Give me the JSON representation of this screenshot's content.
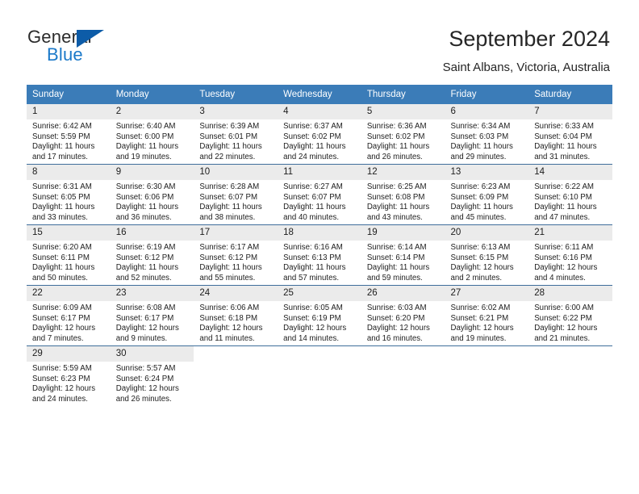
{
  "brand": {
    "name_top": "General",
    "name_bottom": "Blue",
    "triangle_color": "#0d5ca8",
    "blue_color": "#1b79c9"
  },
  "header": {
    "title": "September 2024",
    "subtitle": "Saint Albans, Victoria, Australia",
    "header_bg": "#3b7cb8",
    "daynum_bg": "#ebebeb"
  },
  "weekday_headers": [
    "Sunday",
    "Monday",
    "Tuesday",
    "Wednesday",
    "Thursday",
    "Friday",
    "Saturday"
  ],
  "labels": {
    "sunrise_prefix": "Sunrise:",
    "sunset_prefix": "Sunset:",
    "daylight_prefix": "Daylight:"
  },
  "weeks": [
    [
      {
        "day": "1",
        "sunrise": "Sunrise: 6:42 AM",
        "sunset": "Sunset: 5:59 PM",
        "daylight_line1": "Daylight: 11 hours",
        "daylight_line2": "and 17 minutes."
      },
      {
        "day": "2",
        "sunrise": "Sunrise: 6:40 AM",
        "sunset": "Sunset: 6:00 PM",
        "daylight_line1": "Daylight: 11 hours",
        "daylight_line2": "and 19 minutes."
      },
      {
        "day": "3",
        "sunrise": "Sunrise: 6:39 AM",
        "sunset": "Sunset: 6:01 PM",
        "daylight_line1": "Daylight: 11 hours",
        "daylight_line2": "and 22 minutes."
      },
      {
        "day": "4",
        "sunrise": "Sunrise: 6:37 AM",
        "sunset": "Sunset: 6:02 PM",
        "daylight_line1": "Daylight: 11 hours",
        "daylight_line2": "and 24 minutes."
      },
      {
        "day": "5",
        "sunrise": "Sunrise: 6:36 AM",
        "sunset": "Sunset: 6:02 PM",
        "daylight_line1": "Daylight: 11 hours",
        "daylight_line2": "and 26 minutes."
      },
      {
        "day": "6",
        "sunrise": "Sunrise: 6:34 AM",
        "sunset": "Sunset: 6:03 PM",
        "daylight_line1": "Daylight: 11 hours",
        "daylight_line2": "and 29 minutes."
      },
      {
        "day": "7",
        "sunrise": "Sunrise: 6:33 AM",
        "sunset": "Sunset: 6:04 PM",
        "daylight_line1": "Daylight: 11 hours",
        "daylight_line2": "and 31 minutes."
      }
    ],
    [
      {
        "day": "8",
        "sunrise": "Sunrise: 6:31 AM",
        "sunset": "Sunset: 6:05 PM",
        "daylight_line1": "Daylight: 11 hours",
        "daylight_line2": "and 33 minutes."
      },
      {
        "day": "9",
        "sunrise": "Sunrise: 6:30 AM",
        "sunset": "Sunset: 6:06 PM",
        "daylight_line1": "Daylight: 11 hours",
        "daylight_line2": "and 36 minutes."
      },
      {
        "day": "10",
        "sunrise": "Sunrise: 6:28 AM",
        "sunset": "Sunset: 6:07 PM",
        "daylight_line1": "Daylight: 11 hours",
        "daylight_line2": "and 38 minutes."
      },
      {
        "day": "11",
        "sunrise": "Sunrise: 6:27 AM",
        "sunset": "Sunset: 6:07 PM",
        "daylight_line1": "Daylight: 11 hours",
        "daylight_line2": "and 40 minutes."
      },
      {
        "day": "12",
        "sunrise": "Sunrise: 6:25 AM",
        "sunset": "Sunset: 6:08 PM",
        "daylight_line1": "Daylight: 11 hours",
        "daylight_line2": "and 43 minutes."
      },
      {
        "day": "13",
        "sunrise": "Sunrise: 6:23 AM",
        "sunset": "Sunset: 6:09 PM",
        "daylight_line1": "Daylight: 11 hours",
        "daylight_line2": "and 45 minutes."
      },
      {
        "day": "14",
        "sunrise": "Sunrise: 6:22 AM",
        "sunset": "Sunset: 6:10 PM",
        "daylight_line1": "Daylight: 11 hours",
        "daylight_line2": "and 47 minutes."
      }
    ],
    [
      {
        "day": "15",
        "sunrise": "Sunrise: 6:20 AM",
        "sunset": "Sunset: 6:11 PM",
        "daylight_line1": "Daylight: 11 hours",
        "daylight_line2": "and 50 minutes."
      },
      {
        "day": "16",
        "sunrise": "Sunrise: 6:19 AM",
        "sunset": "Sunset: 6:12 PM",
        "daylight_line1": "Daylight: 11 hours",
        "daylight_line2": "and 52 minutes."
      },
      {
        "day": "17",
        "sunrise": "Sunrise: 6:17 AM",
        "sunset": "Sunset: 6:12 PM",
        "daylight_line1": "Daylight: 11 hours",
        "daylight_line2": "and 55 minutes."
      },
      {
        "day": "18",
        "sunrise": "Sunrise: 6:16 AM",
        "sunset": "Sunset: 6:13 PM",
        "daylight_line1": "Daylight: 11 hours",
        "daylight_line2": "and 57 minutes."
      },
      {
        "day": "19",
        "sunrise": "Sunrise: 6:14 AM",
        "sunset": "Sunset: 6:14 PM",
        "daylight_line1": "Daylight: 11 hours",
        "daylight_line2": "and 59 minutes."
      },
      {
        "day": "20",
        "sunrise": "Sunrise: 6:13 AM",
        "sunset": "Sunset: 6:15 PM",
        "daylight_line1": "Daylight: 12 hours",
        "daylight_line2": "and 2 minutes."
      },
      {
        "day": "21",
        "sunrise": "Sunrise: 6:11 AM",
        "sunset": "Sunset: 6:16 PM",
        "daylight_line1": "Daylight: 12 hours",
        "daylight_line2": "and 4 minutes."
      }
    ],
    [
      {
        "day": "22",
        "sunrise": "Sunrise: 6:09 AM",
        "sunset": "Sunset: 6:17 PM",
        "daylight_line1": "Daylight: 12 hours",
        "daylight_line2": "and 7 minutes."
      },
      {
        "day": "23",
        "sunrise": "Sunrise: 6:08 AM",
        "sunset": "Sunset: 6:17 PM",
        "daylight_line1": "Daylight: 12 hours",
        "daylight_line2": "and 9 minutes."
      },
      {
        "day": "24",
        "sunrise": "Sunrise: 6:06 AM",
        "sunset": "Sunset: 6:18 PM",
        "daylight_line1": "Daylight: 12 hours",
        "daylight_line2": "and 11 minutes."
      },
      {
        "day": "25",
        "sunrise": "Sunrise: 6:05 AM",
        "sunset": "Sunset: 6:19 PM",
        "daylight_line1": "Daylight: 12 hours",
        "daylight_line2": "and 14 minutes."
      },
      {
        "day": "26",
        "sunrise": "Sunrise: 6:03 AM",
        "sunset": "Sunset: 6:20 PM",
        "daylight_line1": "Daylight: 12 hours",
        "daylight_line2": "and 16 minutes."
      },
      {
        "day": "27",
        "sunrise": "Sunrise: 6:02 AM",
        "sunset": "Sunset: 6:21 PM",
        "daylight_line1": "Daylight: 12 hours",
        "daylight_line2": "and 19 minutes."
      },
      {
        "day": "28",
        "sunrise": "Sunrise: 6:00 AM",
        "sunset": "Sunset: 6:22 PM",
        "daylight_line1": "Daylight: 12 hours",
        "daylight_line2": "and 21 minutes."
      }
    ],
    [
      {
        "day": "29",
        "sunrise": "Sunrise: 5:59 AM",
        "sunset": "Sunset: 6:23 PM",
        "daylight_line1": "Daylight: 12 hours",
        "daylight_line2": "and 24 minutes."
      },
      {
        "day": "30",
        "sunrise": "Sunrise: 5:57 AM",
        "sunset": "Sunset: 6:24 PM",
        "daylight_line1": "Daylight: 12 hours",
        "daylight_line2": "and 26 minutes."
      },
      {
        "day": "",
        "sunrise": "",
        "sunset": "",
        "daylight_line1": "",
        "daylight_line2": ""
      },
      {
        "day": "",
        "sunrise": "",
        "sunset": "",
        "daylight_line1": "",
        "daylight_line2": ""
      },
      {
        "day": "",
        "sunrise": "",
        "sunset": "",
        "daylight_line1": "",
        "daylight_line2": ""
      },
      {
        "day": "",
        "sunrise": "",
        "sunset": "",
        "daylight_line1": "",
        "daylight_line2": ""
      },
      {
        "day": "",
        "sunrise": "",
        "sunset": "",
        "daylight_line1": "",
        "daylight_line2": ""
      }
    ]
  ]
}
